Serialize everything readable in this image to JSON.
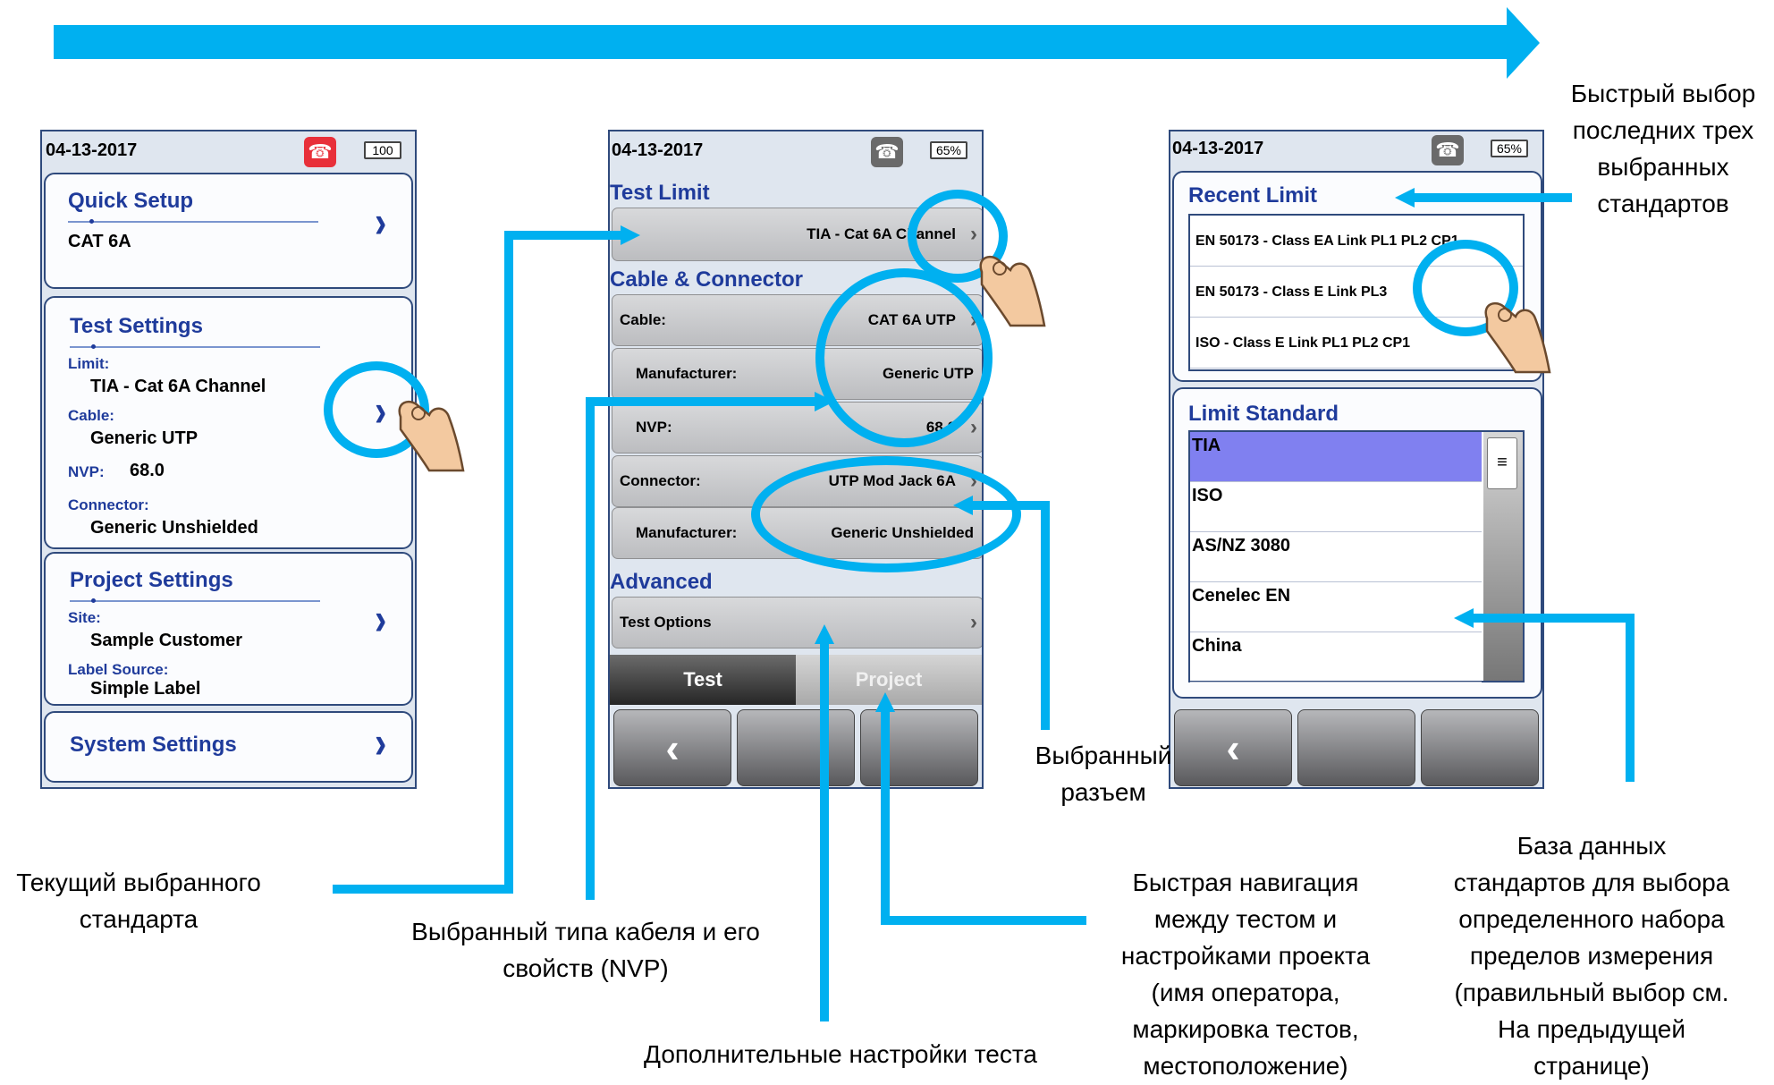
{
  "screen1": {
    "date": "04-13-2017",
    "battery": "100",
    "quick_setup": {
      "title": "Quick Setup",
      "value": "CAT 6A"
    },
    "test_settings": {
      "title": "Test Settings",
      "limit_label": "Limit:",
      "limit_value": "TIA - Cat 6A Channel",
      "cable_label": "Cable:",
      "cable_value": "Generic UTP",
      "nvp_label": "NVP:",
      "nvp_value": "68.0",
      "connector_label": "Connector:",
      "connector_value": "Generic Unshielded"
    },
    "project_settings": {
      "title": "Project Settings",
      "site_label": "Site:",
      "site_value": "Sample Customer",
      "label_source_label": "Label Source:",
      "label_source_value": "Simple Label"
    },
    "system_settings": {
      "title": "System Settings"
    },
    "phone_color": "#e8303a"
  },
  "screen2": {
    "date": "04-13-2017",
    "battery": "65%",
    "test_limit_title": "Test Limit",
    "test_limit_value": "TIA - Cat 6A Channel",
    "cable_connector_title": "Cable & Connector",
    "rows": [
      {
        "label": "Cable:",
        "value": "CAT 6A UTP",
        "chevron": true,
        "indent": false
      },
      {
        "label": "Manufacturer:",
        "value": "Generic UTP",
        "chevron": false,
        "indent": true
      },
      {
        "label": "NVP:",
        "value": "68.0",
        "chevron": true,
        "indent": true
      },
      {
        "label": "Connector:",
        "value": "UTP Mod Jack 6A",
        "chevron": true,
        "indent": false
      },
      {
        "label": "Manufacturer:",
        "value": "Generic Unshielded",
        "chevron": false,
        "indent": true
      }
    ],
    "advanced_title": "Advanced",
    "test_options": "Test Options",
    "tab_test": "Test",
    "tab_project": "Project"
  },
  "screen3": {
    "date": "04-13-2017",
    "battery": "65%",
    "recent_limit_title": "Recent Limit",
    "recent_limits": [
      "EN 50173 - Class EA Link PL1 PL2 CP1",
      "EN 50173 - Class E Link PL3",
      "ISO - Class E Link PL1 PL2 CP1"
    ],
    "limit_standard_title": "Limit Standard",
    "standards": [
      "TIA",
      "ISO",
      "AS/NZ 3080",
      "Cenelec EN",
      "China"
    ],
    "selected_standard": "TIA",
    "selected_color": "#8080f0"
  },
  "annotations": {
    "recent_quick": [
      "Быстрый выбор",
      "последних трех",
      "выбранных",
      "стандартов"
    ],
    "selected_connector": [
      "Выбранный",
      "разъем"
    ],
    "current_standard": [
      "Текущий выбранного",
      "стандарта"
    ],
    "cable_type": [
      "Выбранный типа кабеля и его",
      "свойств (NVP)"
    ],
    "advanced": [
      "Дополнительные настройки теста"
    ],
    "quick_nav": [
      "Быстрая навигация",
      "между тестом и",
      "настройками проекта",
      "(имя оператора,",
      "маркировка тестов,",
      "местоположение)"
    ],
    "database": [
      "База данных",
      "стандартов для выбора",
      "определенного набора",
      "пределов измерения",
      "(правильный выбор см.",
      "На предыдущей",
      "странице)"
    ]
  },
  "colors": {
    "accent": "#00B0F0",
    "title_blue": "#1f3b9b",
    "frame": "#2f4a7c"
  },
  "icons": {
    "back": "chevron-left-icon",
    "forward": "chevron-right-icon",
    "phone": "phone-icon",
    "hand": "pointing-hand-icon"
  }
}
